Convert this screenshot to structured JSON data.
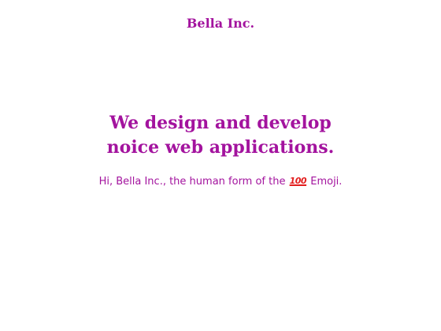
{
  "header": {
    "brand": "Bella Inc."
  },
  "hero": {
    "headline_line1": "We design and develop",
    "headline_line2": "noice web applications.",
    "tagline_prefix": "Hi, Bella Inc., the human form of the",
    "tagline_emoji": "100",
    "tagline_suffix": "Emoji."
  },
  "colors": {
    "accent": "#a3139e",
    "emoji": "#e21d1d",
    "background": "#ffffff"
  },
  "icons": {
    "emoji": "hundred-points-emoji-icon"
  }
}
